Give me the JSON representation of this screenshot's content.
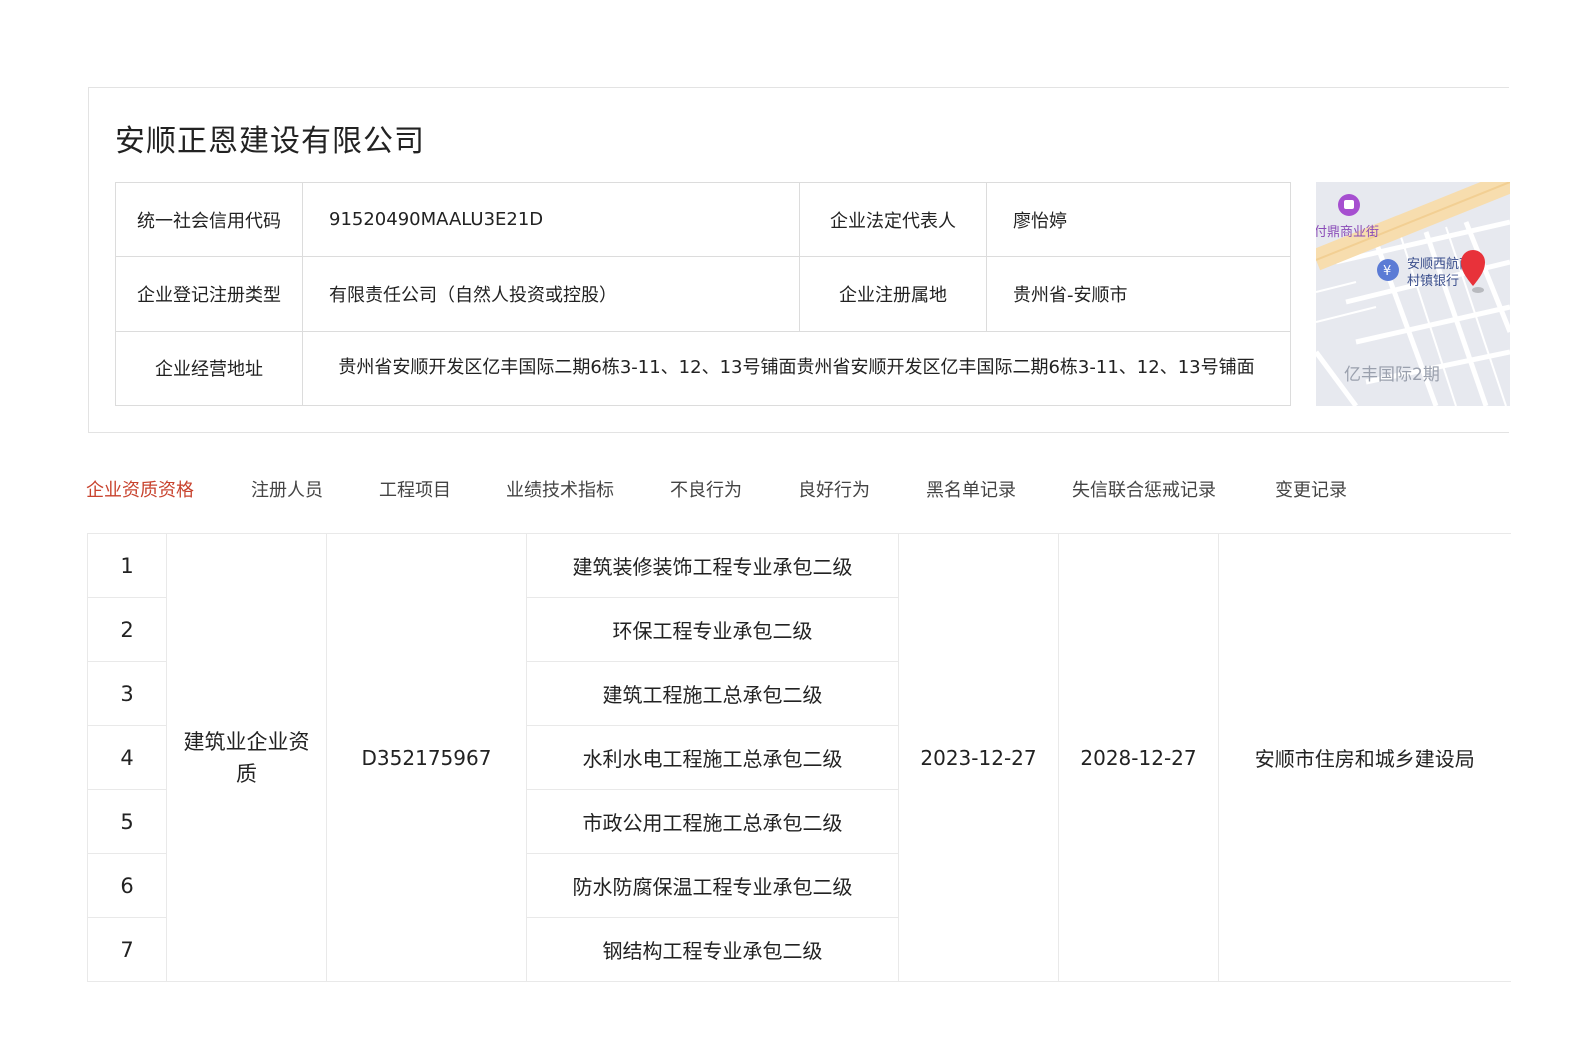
{
  "company": {
    "name": "安顺正恩建设有限公司",
    "info": {
      "credit_code_label": "统一社会信用代码",
      "credit_code": "91520490MAALU3E21D",
      "legal_rep_label": "企业法定代表人",
      "legal_rep": "廖怡婷",
      "reg_type_label": "企业登记注册类型",
      "reg_type": "有限责任公司（自然人投资或控股）",
      "reg_place_label": "企业注册属地",
      "reg_place": "贵州省-安顺市",
      "address_label": "企业经营地址",
      "address": "贵州省安顺开发区亿丰国际二期6栋3-11、12、13号铺面贵州省安顺开发区亿丰国际二期6栋3-11、12、13号铺面"
    }
  },
  "map": {
    "labels": {
      "street": "付鼎商业街",
      "bank": "安顺西航南马",
      "bank2": "村镇银行",
      "area": "亿丰国际2期"
    },
    "colors": {
      "marker": "#e8323a",
      "poi": "#a64fd0",
      "bank": "#5b7bd5",
      "road": "#f7ddae"
    }
  },
  "tabs": [
    {
      "label": "企业资质资格",
      "active": true
    },
    {
      "label": "注册人员",
      "active": false
    },
    {
      "label": "工程项目",
      "active": false
    },
    {
      "label": "业绩技术指标",
      "active": false
    },
    {
      "label": "不良行为",
      "active": false
    },
    {
      "label": "良好行为",
      "active": false
    },
    {
      "label": "黑名单记录",
      "active": false
    },
    {
      "label": "失信联合惩戒记录",
      "active": false
    },
    {
      "label": "变更记录",
      "active": false
    }
  ],
  "qualification": {
    "category": "建筑业企业资质",
    "cert_no": "D352175967",
    "issue_date": "2023-12-27",
    "expiry_date": "2028-12-27",
    "authority": "安顺市住房和城乡建设局",
    "items": [
      {
        "no": "1",
        "name": "建筑装修装饰工程专业承包二级"
      },
      {
        "no": "2",
        "name": "环保工程专业承包二级"
      },
      {
        "no": "3",
        "name": "建筑工程施工总承包二级"
      },
      {
        "no": "4",
        "name": "水利水电工程施工总承包二级"
      },
      {
        "no": "5",
        "name": "市政公用工程施工总承包二级"
      },
      {
        "no": "6",
        "name": "防水防腐保温工程专业承包二级"
      },
      {
        "no": "7",
        "name": "钢结构工程专业承包二级"
      }
    ]
  },
  "colors": {
    "accent": "#c8432e",
    "border": "#dcdcdc"
  }
}
